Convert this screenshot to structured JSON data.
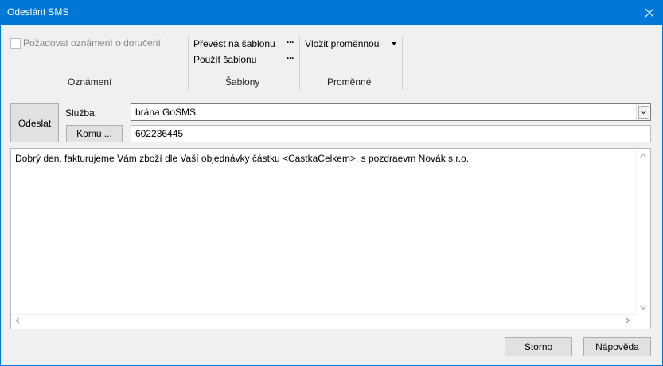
{
  "window": {
    "title": "Odeslání SMS",
    "accent_color": "#0078d7"
  },
  "ribbon": {
    "notifications": {
      "checkbox_label": "Požadovat oznámení o doručení",
      "checked": false,
      "group_label": "Oznámení"
    },
    "templates": {
      "convert_label": "Převést na šablonu",
      "use_label": "Použít šablonu",
      "more_glyph": "···",
      "group_label": "Šablony"
    },
    "variables": {
      "insert_label": "Vložit proměnnou",
      "group_label": "Proměnné"
    }
  },
  "form": {
    "send_button": "Odeslat",
    "service_label": "Služba:",
    "service_value": "brána GoSMS",
    "to_button": "Komu ...",
    "to_value": "602236445",
    "message": "Dobrý den, fakturujeme Vám zboží dle Vaší objednávky částku <CastkaCelkem>. s pozdraevm Novák s.r.o."
  },
  "footer": {
    "cancel_button": "Storno",
    "help_button": "Nápověda"
  }
}
